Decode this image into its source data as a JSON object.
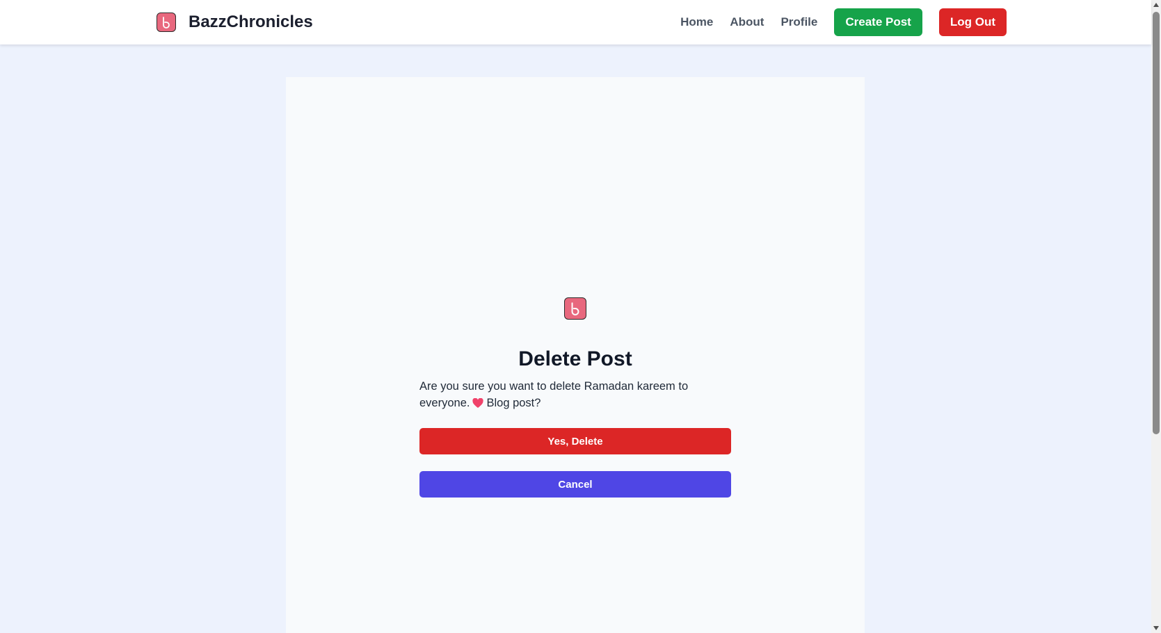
{
  "app": {
    "brand_name": "BazzChronicles",
    "logo_icon": "b-logo-icon",
    "brand_color": "#e8687e"
  },
  "nav": {
    "home": "Home",
    "about": "About",
    "profile": "Profile",
    "create_post": "Create Post",
    "log_out": "Log Out",
    "create_color": "#16a34a",
    "logout_color": "#dc2626"
  },
  "dialog": {
    "title": "Delete Post",
    "message_before": "Are you sure you want to delete Ramadan kareem to everyone.",
    "message_emoji": "heart-icon",
    "message_after": "Blog post?",
    "confirm_label": "Yes, Delete",
    "cancel_label": "Cancel",
    "confirm_color": "#dc2626",
    "cancel_color": "#4f46e5"
  }
}
